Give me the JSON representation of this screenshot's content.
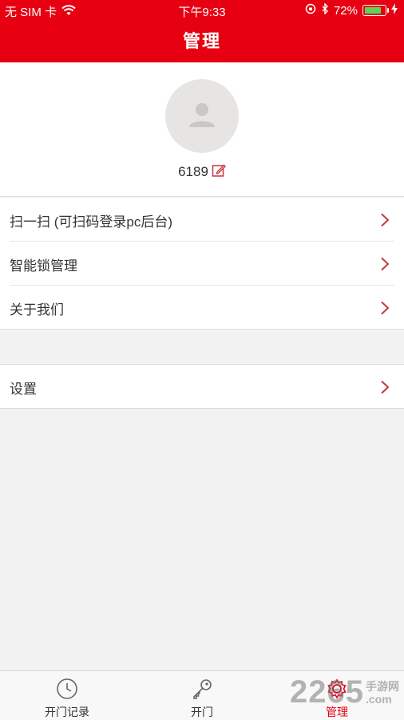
{
  "status_bar": {
    "carrier": "无 SIM 卡",
    "time": "下午9:33",
    "battery": "72%",
    "battery_level": 0.72
  },
  "header": {
    "title": "管理"
  },
  "profile": {
    "username": "6189"
  },
  "menu_group_1": [
    {
      "label": "扫一扫 (可扫码登录pc后台)"
    },
    {
      "label": "智能锁管理"
    },
    {
      "label": "关于我们"
    }
  ],
  "menu_group_2": [
    {
      "label": "设置"
    }
  ],
  "tabbar": {
    "tabs": [
      {
        "label": "开门记录",
        "icon": "clock-icon"
      },
      {
        "label": "开门",
        "icon": "key-icon"
      },
      {
        "label": "管理",
        "icon": "gear-icon",
        "active": true
      }
    ]
  },
  "watermark": {
    "number": "2265",
    "text1": "手游网",
    "text2": ".com"
  },
  "colors": {
    "accent": "#e60012",
    "background": "#f2f2f2",
    "chevron": "#c8363c"
  }
}
